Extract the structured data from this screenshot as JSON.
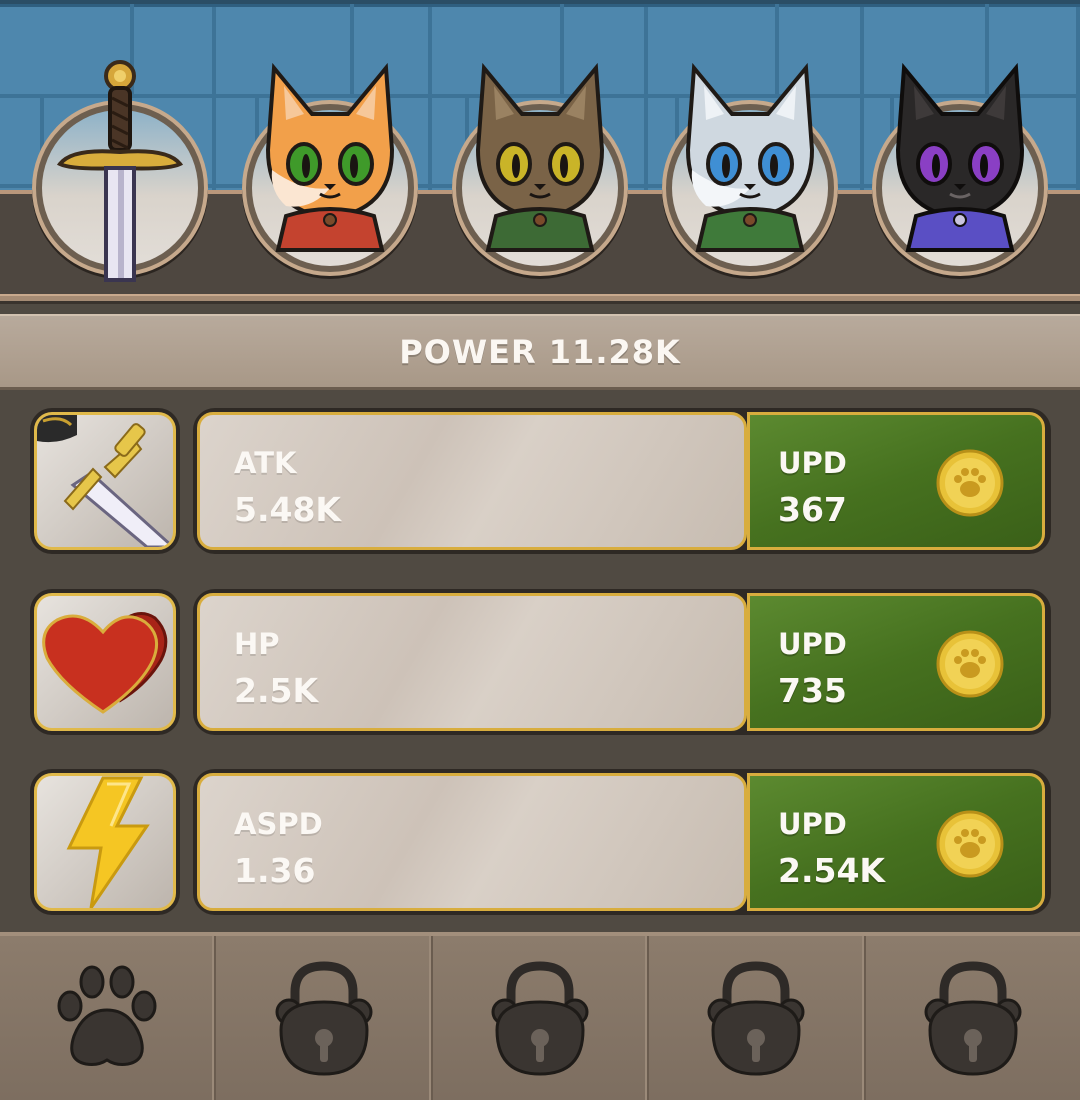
{
  "power": {
    "label": "POWER 11.28K"
  },
  "heroes": [
    {
      "name": "sword",
      "icon": "sword-icon"
    },
    {
      "name": "orange-cat",
      "fur": "#f2a04a",
      "eye": "#3f9a2a",
      "cape": "#c4432f"
    },
    {
      "name": "brown-cat",
      "fur": "#7a6347",
      "eye": "#c9b428",
      "cape": "#3d6a35"
    },
    {
      "name": "white-cat",
      "fur": "#cfd8e0",
      "eye": "#3f8fd4",
      "cape": "#3f7a3a"
    },
    {
      "name": "black-cat",
      "fur": "#2a2828",
      "eye": "#8a3fc4",
      "cape": "#5a4fc4"
    }
  ],
  "stats": [
    {
      "label": "ATK",
      "value": "5.48K",
      "icon": "sword-stat-icon",
      "upgrade": {
        "label": "UPD",
        "cost": "367"
      }
    },
    {
      "label": "HP",
      "value": "2.5K",
      "icon": "heart-icon",
      "upgrade": {
        "label": "UPD",
        "cost": "735"
      }
    },
    {
      "label": "ASPD",
      "value": "1.36",
      "icon": "lightning-icon",
      "upgrade": {
        "label": "UPD",
        "cost": "2.54K"
      }
    }
  ],
  "nav": [
    {
      "icon": "paw-icon",
      "locked": false
    },
    {
      "icon": "lock-icon",
      "locked": true
    },
    {
      "icon": "lock-icon",
      "locked": true
    },
    {
      "icon": "lock-icon",
      "locked": true
    },
    {
      "icon": "lock-icon",
      "locked": true
    }
  ],
  "colors": {
    "wall": "#4e87ad",
    "upgrade_green": "#46711f",
    "gold_border": "#d8ad3e",
    "coin": "#e8c238"
  }
}
